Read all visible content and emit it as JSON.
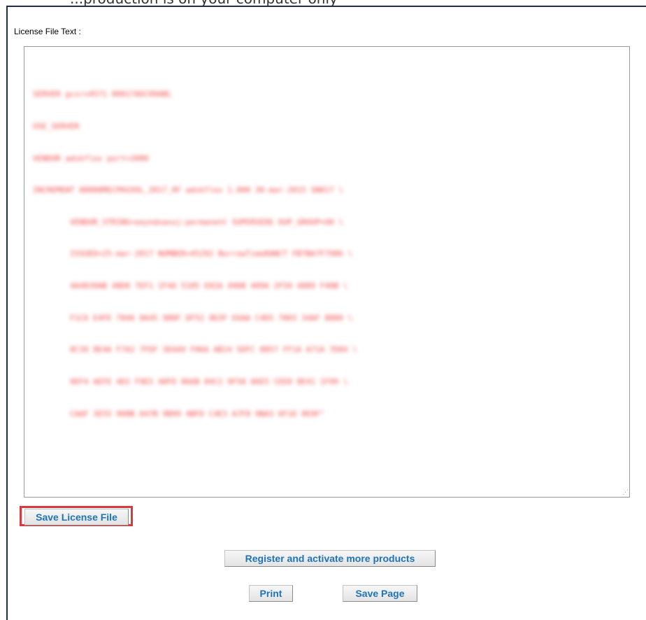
{
  "header": {
    "cut_text": "...production is on your computer only"
  },
  "license": {
    "label": "License File Text :",
    "lines": [
      "SERVER gcsrv4571 00017A6C09ABL",
      "USE_SERVER",
      "VENDOR adskflex port=2080",
      "INCREMENT 88888MECPKGVOL_2017_0F adskflex 1.000 30-mar-2015 SN017 \\",
      "        VENDOR_STRING=oeyndxaxuj:permanent SUPERSEDE DUP_GROUP=UH \\",
      "        ISSUED=25-mar-2017 NUMBER=45292 BorrowTimeRANCT FB7BA7F7986 \\",
      "        4A4839AB 48D0 7EF1 1F4A 5185 E02A 496B 409A 2F59 4889 F40B \\",
      "        F1C6 E4FE 7846 0A45 988F DF52 9D3F E6AA C4D5 7865 34AF 8880 \\",
      "        8C39 8E4A F7A2 7FDF 3E6A9 F06A AB14 5DFC 8857 FF1A A71A 7D84 \\",
      "        9EF4 AEFE 4D2 F9E5 40FD 866B 84C2 9F58 A6E5 CEE0 8E41 1F99 \\",
      "        CAAF 3E55 908B A47B 9B99 4BFD C4E3 A7F8 9BA3 6F1D 0E9F\""
    ]
  },
  "buttons": {
    "save_license": "Save License File",
    "register_more": "Register and activate more products",
    "print": "Print",
    "save_page": "Save Page"
  },
  "colors": {
    "button_text": "#1f73b7",
    "highlight_border": "#d9383f",
    "license_text": "#f04040"
  }
}
